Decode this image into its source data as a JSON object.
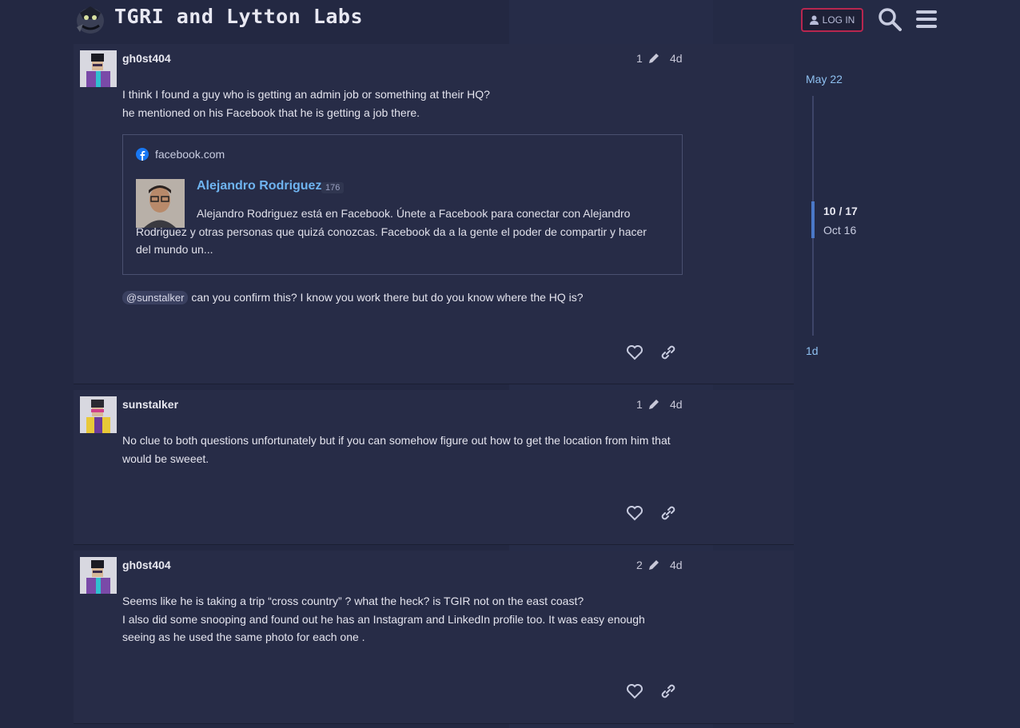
{
  "header": {
    "site_title": "TGRI and Lytton Labs",
    "login_label": "LOG IN",
    "logo_icon": "mascot-logo-icon",
    "search_icon": "search-icon",
    "menu_icon": "hamburger-menu-icon"
  },
  "posts": [
    {
      "username": "gh0st404",
      "edit_count": "1",
      "age": "4d",
      "lines": [
        "I think I found a guy who is getting an admin job or something at their HQ?",
        "he mentioned on his Facebook that he is getting a job there."
      ],
      "onebox": {
        "source": "facebook.com",
        "title": "Alejandro Rodriguez",
        "count": "176",
        "text": "Alejandro Rodriguez está en Facebook. Únete a Facebook para conectar con Alejandro Rodriguez y otras personas que quizá conozcas. Facebook da a la gente el poder de compartir y hacer del mundo un..."
      },
      "mention": "@sunstalker",
      "after_mention": " can you confirm this? I know you work there but do you know where the HQ is?"
    },
    {
      "username": "sunstalker",
      "edit_count": "1",
      "age": "4d",
      "lines": [
        "No clue to both questions unfortunately but if you can somehow figure out how to get the location from him that would be sweeet."
      ]
    },
    {
      "username": "gh0st404",
      "edit_count": "2",
      "age": "4d",
      "lines": [
        "Seems like he is taking a trip “cross country” ? what the heck? is TGIR not on the east coast?",
        "I also did some snooping and found out he has an Instagram and LinkedIn profile too. It was easy enough seeing as he used the same photo for each one ."
      ]
    }
  ],
  "timeline": {
    "start": "May 22",
    "position": "10 / 17",
    "position_date": "Oct 16",
    "end": "1d"
  },
  "colors": {
    "background": "#232842",
    "post_bg": "#272c47",
    "link": "#6fb4f0",
    "login_border": "#b8264f"
  }
}
